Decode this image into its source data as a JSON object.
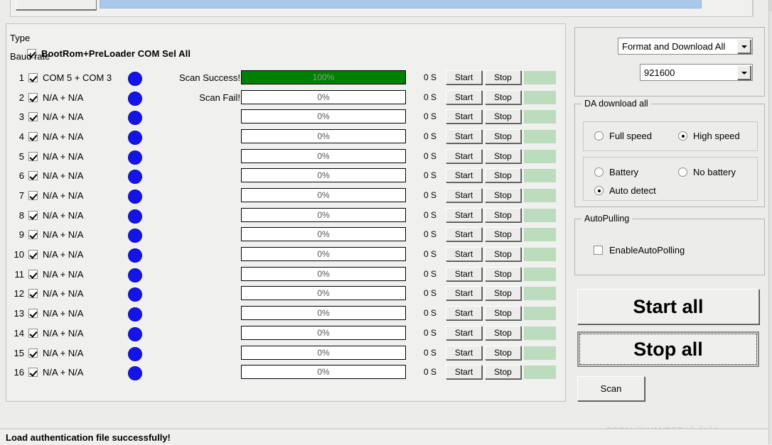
{
  "header": {
    "select_all_label": "BootRom+PreLoader COM Sel All"
  },
  "columns": {
    "scan_success_label": "Scan Success!",
    "scan_fail_label": "Scan Fail!",
    "start_label": "Start",
    "stop_label": "Stop",
    "seconds_label": "0 S"
  },
  "rows": [
    {
      "num": "1",
      "port": "COM 5 + COM 3",
      "percent": "100%",
      "fill": 100,
      "secs": "0 S",
      "scan_label": "Scan Success!"
    },
    {
      "num": "2",
      "port": "N/A + N/A",
      "percent": "0%",
      "fill": 0,
      "secs": "0 S",
      "scan_label": "Scan Fail!"
    },
    {
      "num": "3",
      "port": "N/A + N/A",
      "percent": "0%",
      "fill": 0,
      "secs": "0 S",
      "scan_label": ""
    },
    {
      "num": "4",
      "port": "N/A + N/A",
      "percent": "0%",
      "fill": 0,
      "secs": "0 S",
      "scan_label": ""
    },
    {
      "num": "5",
      "port": "N/A + N/A",
      "percent": "0%",
      "fill": 0,
      "secs": "0 S",
      "scan_label": ""
    },
    {
      "num": "6",
      "port": "N/A + N/A",
      "percent": "0%",
      "fill": 0,
      "secs": "0 S",
      "scan_label": ""
    },
    {
      "num": "7",
      "port": "N/A + N/A",
      "percent": "0%",
      "fill": 0,
      "secs": "0 S",
      "scan_label": ""
    },
    {
      "num": "8",
      "port": "N/A + N/A",
      "percent": "0%",
      "fill": 0,
      "secs": "0 S",
      "scan_label": ""
    },
    {
      "num": "9",
      "port": "N/A + N/A",
      "percent": "0%",
      "fill": 0,
      "secs": "0 S",
      "scan_label": ""
    },
    {
      "num": "10",
      "port": "N/A + N/A",
      "percent": "0%",
      "fill": 0,
      "secs": "0 S",
      "scan_label": ""
    },
    {
      "num": "11",
      "port": "N/A + N/A",
      "percent": "0%",
      "fill": 0,
      "secs": "0 S",
      "scan_label": ""
    },
    {
      "num": "12",
      "port": "N/A + N/A",
      "percent": "0%",
      "fill": 0,
      "secs": "0 S",
      "scan_label": ""
    },
    {
      "num": "13",
      "port": "N/A + N/A",
      "percent": "0%",
      "fill": 0,
      "secs": "0 S",
      "scan_label": ""
    },
    {
      "num": "14",
      "port": "N/A + N/A",
      "percent": "0%",
      "fill": 0,
      "secs": "0 S",
      "scan_label": ""
    },
    {
      "num": "15",
      "port": "N/A + N/A",
      "percent": "0%",
      "fill": 0,
      "secs": "0 S",
      "scan_label": ""
    },
    {
      "num": "16",
      "port": "N/A + N/A",
      "percent": "0%",
      "fill": 0,
      "secs": "0 S",
      "scan_label": ""
    }
  ],
  "settings": {
    "type_label": "Type",
    "type_value": "Format and Download All",
    "baud_label": "Baud rate",
    "baud_value": "921600"
  },
  "da_download": {
    "caption": "DA download all",
    "speed": [
      {
        "label": "Full speed",
        "selected": false
      },
      {
        "label": "High speed",
        "selected": true
      }
    ],
    "battery": [
      {
        "label": "Battery",
        "selected": false
      },
      {
        "label": "No battery",
        "selected": false
      },
      {
        "label": "Auto detect",
        "selected": true
      }
    ]
  },
  "autopulling": {
    "caption": "AutoPulling",
    "enable_label": "EnableAutoPolling",
    "enabled": false
  },
  "actions": {
    "start_all": "Start all",
    "stop_all": "Stop all",
    "scan": "Scan"
  },
  "status": {
    "message": "Load authentication file successfully!"
  },
  "watermark": {
    "text": "CSDN @WANDER(小火山)"
  },
  "colors": {
    "progress_fill": "#008000",
    "row_dot": "#1414e8",
    "state_cell": "#bcdcbe",
    "selected_field": "#a8c9ec"
  }
}
